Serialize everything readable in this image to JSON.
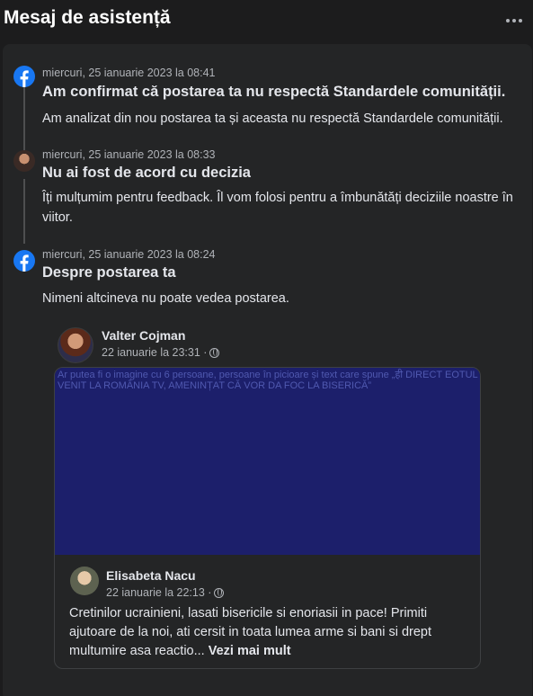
{
  "header": {
    "title": "Mesaj de asistență"
  },
  "timeline": [
    {
      "timestamp": "miercuri, 25 ianuarie 2023 la 08:41",
      "title": "Am confirmat că postarea ta nu respectă Standardele comunității.",
      "body": "Am analizat din nou postarea ta și aceasta nu respectă Standardele comunității."
    },
    {
      "timestamp": "miercuri, 25 ianuarie 2023 la 08:33",
      "title": "Nu ai fost de acord cu decizia",
      "body": "Îți mulțumim pentru feedback. Îl vom folosi pentru a îmbunătăți deciziile noastre în viitor."
    },
    {
      "timestamp": "miercuri, 25 ianuarie 2023 la 08:24",
      "title": "Despre postarea ta",
      "body": "Nimeni altcineva nu poate vedea postarea."
    }
  ],
  "post": {
    "author": "Valter Cojman",
    "date": "22 ianuarie la 23:31 ·",
    "image_alt": "Ar putea fi o imagine cu 6 persoane, persoane în picioare și text care spune „ही DIRECT EOTUL VENIT LA ROMÂNIA TV, AMENINȚAT CĂ VOR DA FOC LA BISERICĂ”",
    "shared": {
      "author": "Elisabeta Nacu",
      "date": "22 ianuarie la 22:13 ·",
      "text": "Cretinilor ucrainieni, lasati bisericile si enoriasii in pace! Primiti ajutoare de la noi, ati cersit in toata lumea arme si bani si drept multumire asa reactio...",
      "see_more": "Vezi mai mult"
    }
  },
  "colors": {
    "facebook_blue": "#1877f2",
    "image_placeholder": "#1c1f6b"
  },
  "icons": [
    "more-options-icon",
    "facebook-icon",
    "globe-icon"
  ]
}
